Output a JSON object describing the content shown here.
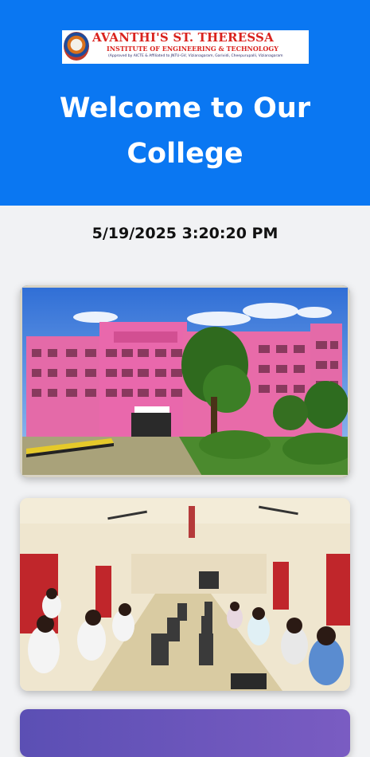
{
  "header": {
    "logo": {
      "title": "AVANTHI'S ST. THERESSA",
      "subtitle": "INSTITUTE OF ENGINEERING & TECHNOLOGY",
      "tagline": "(Approved by AICTE & Affiliated to JNTU-GV, Vizianagaram, Garividi, Cheepurupalli, Vizianagaram",
      "emblem_icon": "college-emblem-icon"
    },
    "welcome_text": "Welcome to Our College",
    "background_color": "#0a77f2"
  },
  "datetime": "5/19/2025 3:20:20 PM",
  "gallery": {
    "images": [
      {
        "name": "college-building-photo"
      },
      {
        "name": "computer-lab-photo"
      },
      {
        "name": "purple-gradient-photo"
      }
    ]
  }
}
